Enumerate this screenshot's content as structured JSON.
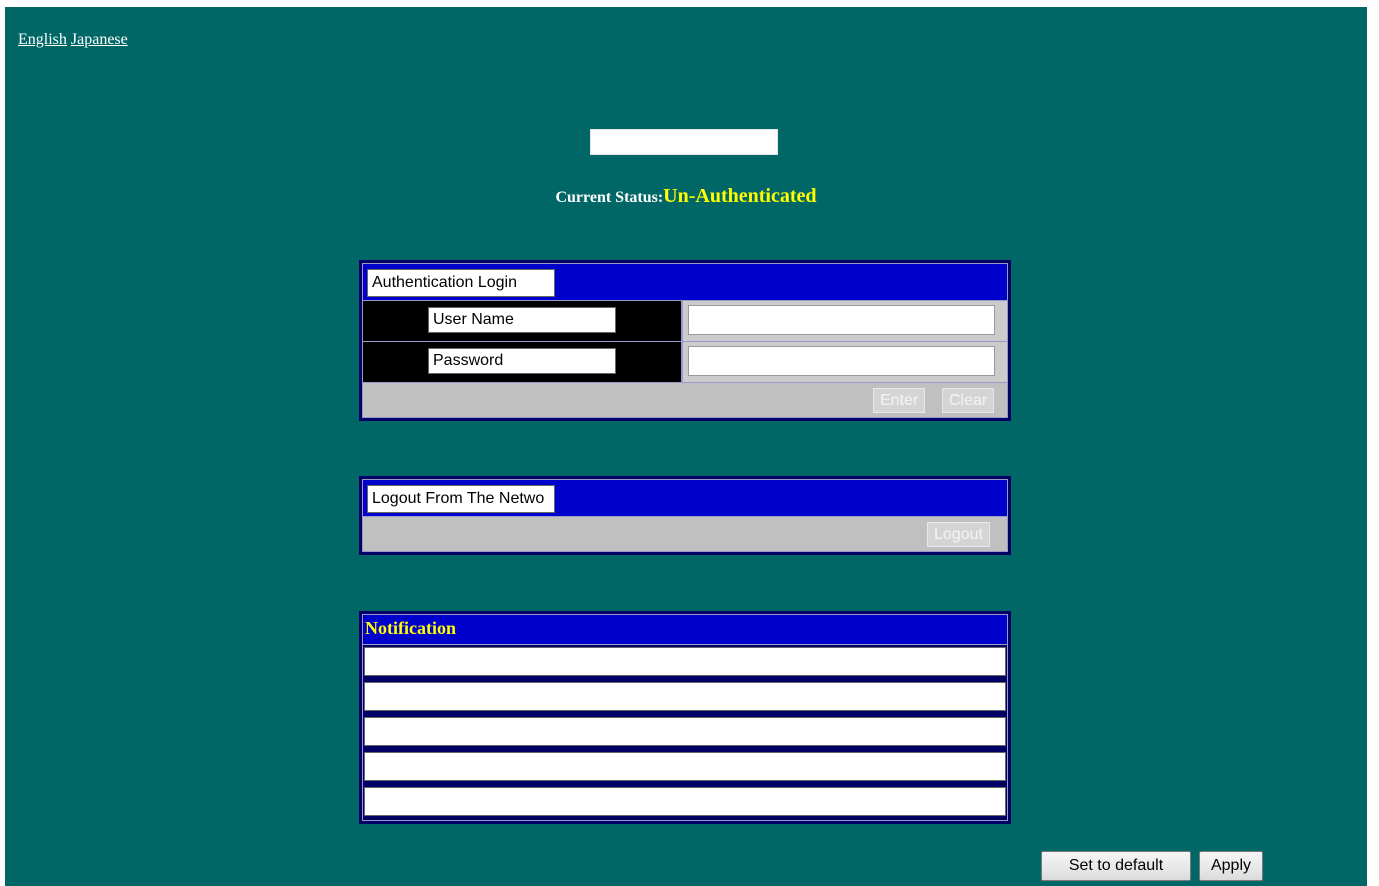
{
  "language_links": [
    "English",
    "Japanese"
  ],
  "status": {
    "label": "Current Status:",
    "value": "Un-Authenticated"
  },
  "auth_panel": {
    "header": "Authentication Login",
    "fields": [
      {
        "label": "User Name",
        "value": ""
      },
      {
        "label": "Password",
        "value": ""
      }
    ],
    "enter_button": "Enter",
    "clear_button": "Clear"
  },
  "logout_panel": {
    "header": "Logout From The Netwo",
    "logout_button": "Logout"
  },
  "notification": {
    "header": "Notification",
    "lines": [
      "",
      "",
      "",
      "",
      ""
    ]
  },
  "footer": {
    "set_default_button": "Set to default",
    "apply_button": "Apply"
  }
}
